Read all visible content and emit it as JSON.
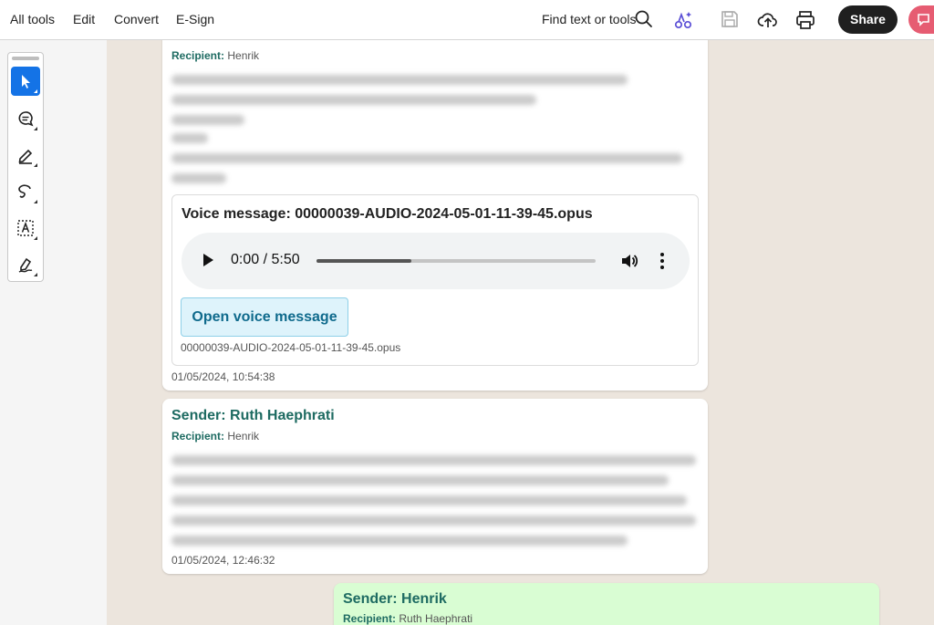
{
  "toolbar": {
    "menu": [
      "All tools",
      "Edit",
      "Convert",
      "E-Sign"
    ],
    "find_label": "Find text or tools",
    "share_label": "Share",
    "icons": [
      "search-icon",
      "ai-assistant-icon",
      "save-icon",
      "upload-icon",
      "print-icon",
      "ai-chat-icon"
    ]
  },
  "tool_rail": {
    "tools": [
      "select-tool",
      "comment-tool",
      "highlight-tool",
      "lasso-tool",
      "text-select-tool",
      "sign-tool"
    ],
    "active": "select-tool"
  },
  "messages": [
    {
      "recipient_label": "Recipient:",
      "recipient": "Henrik",
      "voice": {
        "title": "Voice message: 00000039-AUDIO-2024-05-01-11-39-45.opus",
        "time": "0:00 / 5:50",
        "progress_fraction": 0.34,
        "open_label": "Open voice message",
        "file": "00000039-AUDIO-2024-05-01-11-39-45.opus"
      },
      "timestamp": "01/05/2024, 10:54:38"
    },
    {
      "sender": "Sender: Ruth Haephrati",
      "recipient_label": "Recipient:",
      "recipient": "Henrik",
      "timestamp": "01/05/2024, 12:46:32"
    },
    {
      "sender": "Sender: Henrik",
      "recipient_label": "Recipient:",
      "recipient": "Ruth Haephrati"
    }
  ],
  "colors": {
    "accent": "#1473e6",
    "sender_green": "#1e6b62",
    "outgoing_bubble": "#d9fdd3",
    "share_bg": "#1f1f1f",
    "ai_btn": "#e65c72"
  }
}
